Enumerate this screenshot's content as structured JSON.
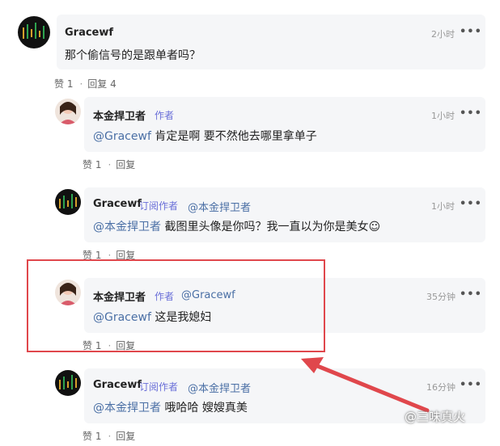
{
  "comments": [
    {
      "user": "Gracewf",
      "time": "2小时",
      "text": "那个偷信号的是跟单者吗？",
      "like": "赞 1",
      "reply": "回复 4"
    },
    {
      "user": "本金捍卫者",
      "tag": "作者",
      "time": "1小时",
      "mention": "@Gracewf",
      "text": " 肯定是啊 要不然他去哪里拿单子",
      "like": "赞 1",
      "reply": "回复"
    },
    {
      "user": "Gracewf",
      "tag": "订阅作者",
      "head_mention": "@本金捍卫者",
      "time": "1小时",
      "mention": "@本金捍卫者",
      "text": " 截图里头像是你吗？我一直以为你是美女☺",
      "like": "赞 1",
      "reply": "回复"
    },
    {
      "user": "本金捍卫者",
      "tag": "作者",
      "head_mention": "@Gracewf",
      "time": "35分钟",
      "mention": "@Gracewf",
      "text": " 这是我媳妇",
      "like": "赞 1",
      "reply": "回复"
    },
    {
      "user": "Gracewf",
      "tag": "订阅作者",
      "head_mention": "@本金捍卫者",
      "time": "16分钟",
      "mention": "@本金捍卫者",
      "text": " 哦哈哈 嫂嫂真美",
      "like": "赞 1",
      "reply": "回复"
    }
  ],
  "more_label": "•••",
  "watermark": "@三味真火",
  "colors": {
    "highlight": "#e0474c",
    "mention": "#4a6fa5",
    "tag": "#6a6fd8"
  }
}
